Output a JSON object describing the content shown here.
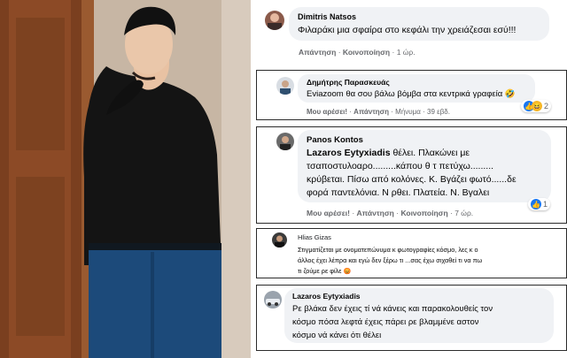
{
  "comments": [
    {
      "author": "Dimitris Natsos",
      "text": "Φιλαράκι μια σφαίρα στο κεφάλι την χρειάζεσαι εσύ!!!",
      "actions": [
        "Απάντηση",
        "Κοινοποίηση"
      ],
      "time": "1 ώρ."
    },
    {
      "author": "Δημήτρης Παρασκευάς",
      "text": "Eviazoom θα σου βάλω βόμβα στα κεντρικά γραφεία 🤣",
      "actions": [
        "Μου αρέσει!",
        "Απάντηση",
        "Μήνυμα"
      ],
      "time": "39 εβδ.",
      "reaction_count": "2"
    },
    {
      "author": "Panos Kontos",
      "mention": "Lazaros Eytyxiadis",
      "lines": [
        " θέλει. Πλακώνει με",
        "τσαποστυλοαρο.........κάπου θ τ πετύχω.........",
        "κρύβεται. Πίσω από κολόνες. Κ. Βγάζει φωτό......δε",
        "φορά παντελόνια. Ν ρθει. Πλατεία. Ν. Βγαλει"
      ],
      "actions": [
        "Μου αρέσει!",
        "Απάντηση",
        "Κοινοποίηση"
      ],
      "time": "7 ώρ.",
      "reaction_count": "1"
    },
    {
      "author": "Hlias Gizas",
      "lines": [
        "Στιγματίζεται με ονοματεπώνυμα κ φωτογραφίες κόσμο, λες κ ο",
        "άλλος έχει λέπρα και εγώ δεν ξέρω τι ...σας έχω σιχαθεί τι να πω",
        "τι ζούμε ρε φίλε"
      ],
      "emoji": "😡"
    },
    {
      "author": "Lazaros Eytyxiadis",
      "lines": [
        "Ρε βλάκα δεν έχεις τί νά κάνεις και παρακολουθείς τον",
        "κόσμο πόσα λεφτά έχεις πάρει ρε βλαμμένε αστον",
        "κόσμο νά κάνει ότι θέλει"
      ]
    }
  ],
  "icons": {
    "like": "thumbs-up-icon",
    "haha": "haha-icon"
  },
  "colors": {
    "bubble": "#f0f2f5",
    "like": "#1877f2",
    "meta": "#65676b"
  }
}
